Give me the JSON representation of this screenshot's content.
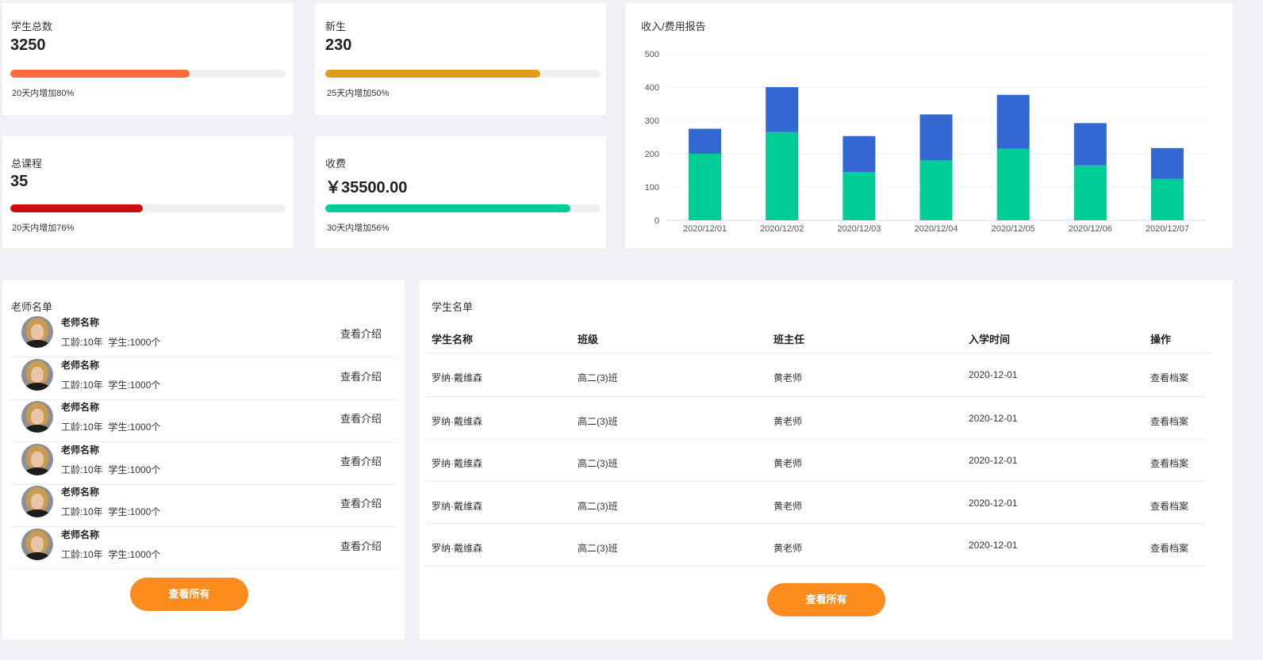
{
  "stats": [
    {
      "title": "学生总数",
      "value": "3250",
      "note": "20天内增加80%",
      "percent": 65,
      "color": "#ff6a3d"
    },
    {
      "title": "新生",
      "value": "230",
      "note": "25天内增加50%",
      "percent": 78,
      "color": "#e39b1e"
    },
    {
      "title": "总课程",
      "value": "35",
      "note": "20天内增加76%",
      "percent": 48,
      "color": "#d10a0a"
    },
    {
      "title": "收费",
      "value": "￥35500.00",
      "note": "30天内增加56%",
      "percent": 89,
      "color": "#00cc96"
    }
  ],
  "report": {
    "title": "收入/费用报告"
  },
  "chart_data": {
    "type": "bar",
    "stacked": true,
    "title": "收入/费用报告",
    "categories": [
      "2020/12/01",
      "2020/12/02",
      "2020/12/03",
      "2020/12/04",
      "2020/12/05",
      "2020/12/06",
      "2020/12/07"
    ],
    "series": [
      {
        "values": [
          200,
          265,
          145,
          180,
          215,
          165,
          125
        ],
        "color": "#00cc96"
      },
      {
        "values": [
          75,
          135,
          108,
          138,
          162,
          127,
          92
        ],
        "color": "#3367d1"
      }
    ],
    "ylim": [
      0,
      500
    ],
    "yticks": [
      0,
      100,
      200,
      300,
      400,
      500
    ],
    "grid": true
  },
  "teachers": {
    "title": "老师名单",
    "items": [
      {
        "name": "老师名称",
        "meta": "工龄:10年  学生:1000个",
        "action": "查看介绍"
      },
      {
        "name": "老师名称",
        "meta": "工龄:10年  学生:1000个",
        "action": "查看介绍"
      },
      {
        "name": "老师名称",
        "meta": "工龄:10年  学生:1000个",
        "action": "查看介绍"
      },
      {
        "name": "老师名称",
        "meta": "工龄:10年  学生:1000个",
        "action": "查看介绍"
      },
      {
        "name": "老师名称",
        "meta": "工龄:10年  学生:1000个",
        "action": "查看介绍"
      },
      {
        "name": "老师名称",
        "meta": "工龄:10年  学生:1000个",
        "action": "查看介绍"
      }
    ],
    "view_all": "查看所有"
  },
  "students": {
    "title": "学生名单",
    "columns": [
      "学生名称",
      "班级",
      "班主任",
      "入学时间",
      "操作"
    ],
    "rows": [
      [
        "罗纳·戴维森",
        "高二(3)班",
        "黄老师",
        "2020-12-01",
        "查看档案"
      ],
      [
        "罗纳·戴维森",
        "高二(3)班",
        "黄老师",
        "2020-12-01",
        "查看档案"
      ],
      [
        "罗纳·戴维森",
        "高二(3)班",
        "黄老师",
        "2020-12-01",
        "查看档案"
      ],
      [
        "罗纳·戴维森",
        "高二(3)班",
        "黄老师",
        "2020-12-01",
        "查看档案"
      ],
      [
        "罗纳·戴维森",
        "高二(3)班",
        "黄老师",
        "2020-12-01",
        "查看档案"
      ]
    ],
    "view_all": "查看所有"
  }
}
